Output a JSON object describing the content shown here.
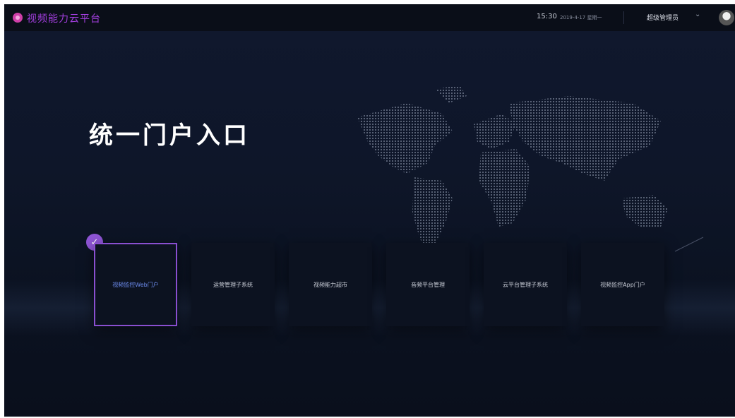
{
  "header": {
    "brand": "视频能力云平台",
    "time": "15:30",
    "date": "2019-4-17 星期一",
    "user": "超级管理员"
  },
  "main": {
    "title": "统一门户入口",
    "portals": [
      {
        "label": "视频监控Web门户",
        "selected": true
      },
      {
        "label": "运营管理子系统",
        "selected": false
      },
      {
        "label": "视频能力超市",
        "selected": false
      },
      {
        "label": "音频平台管理",
        "selected": false
      },
      {
        "label": "云平台管理子系统",
        "selected": false
      },
      {
        "label": "视频监控App门户",
        "selected": false
      }
    ]
  },
  "icons": {
    "logo": "logo-icon",
    "dropdown": "chevron-down-icon",
    "avatar": "avatar",
    "check": "check-icon"
  },
  "colors": {
    "accent": "#8f55d6",
    "brand": "#a43fe0",
    "background": "#0e1629"
  }
}
